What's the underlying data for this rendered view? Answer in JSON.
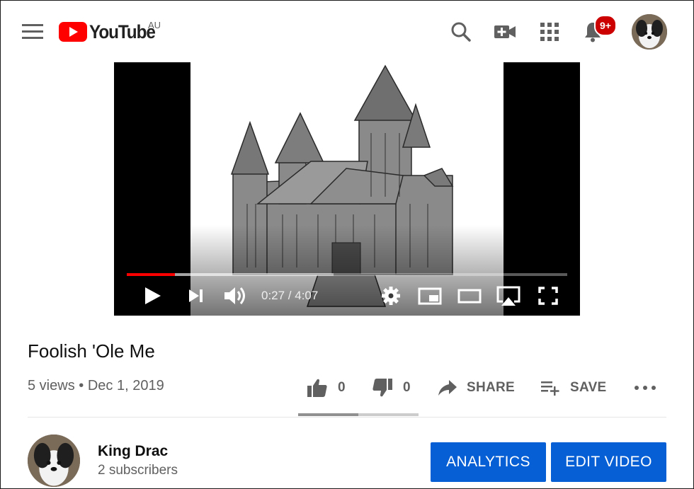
{
  "header": {
    "logo_text": "YouTube",
    "country_code": "AU",
    "notification_count": "9+"
  },
  "player": {
    "current_time": "0:27",
    "duration": "4:07",
    "time_display": "0:27 / 4:07",
    "played_fraction": 0.11,
    "loaded_fraction": 0.47,
    "accent": "#ff0000"
  },
  "video": {
    "title": "Foolish 'Ole Me",
    "views": "5 views",
    "separator": "•",
    "date": "Dec 1, 2019"
  },
  "actions": {
    "like_count": "0",
    "dislike_count": "0",
    "share_label": "SHARE",
    "save_label": "SAVE",
    "like_fraction": 0.5
  },
  "channel": {
    "name": "King Drac",
    "subscribers": "2 subscribers"
  },
  "buttons": {
    "analytics": "ANALYTICS",
    "edit_video": "EDIT VIDEO",
    "color": "#065fd4"
  },
  "icons": [
    "menu-icon",
    "youtube-logo-icon",
    "search-icon",
    "create-video-icon",
    "apps-icon",
    "notifications-icon",
    "play-icon",
    "next-icon",
    "volume-icon",
    "settings-icon",
    "miniplayer-icon",
    "theater-mode-icon",
    "airplay-icon",
    "fullscreen-icon",
    "thumbs-up-icon",
    "thumbs-down-icon",
    "share-icon",
    "save-playlist-icon",
    "more-icon"
  ]
}
